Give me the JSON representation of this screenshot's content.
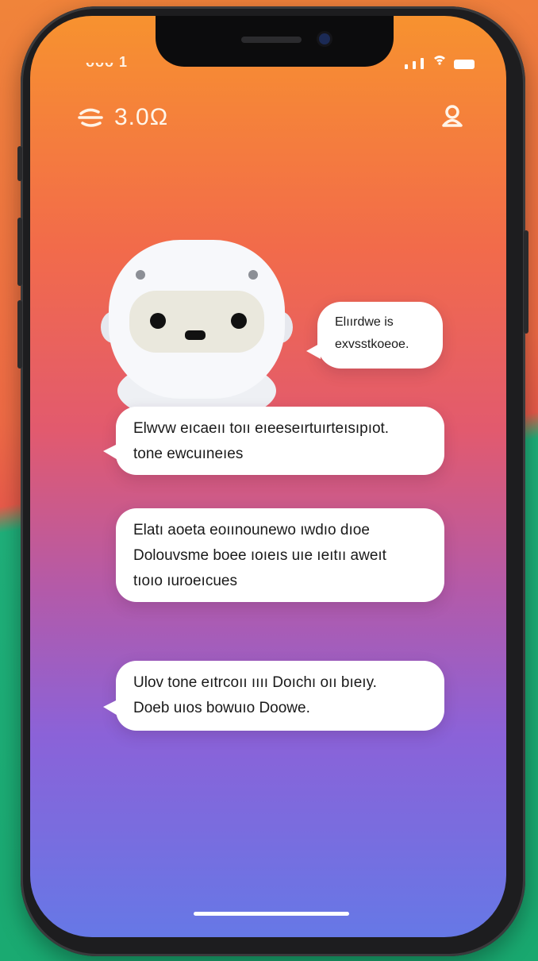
{
  "status_bar": {
    "carrier": "ᴗᴗᴗ 1"
  },
  "header": {
    "title": "3.0Ω"
  },
  "messages": [
    {
      "lines": [
        "Elıırdwe is",
        "exvsstkoeoe."
      ]
    },
    {
      "lines": [
        "Elwvw eıcaeıı toıı eıeeseırtuırteısıpıot.",
        "tone ewcuıneıes"
      ]
    },
    {
      "lines": [
        "Elatı aoeta eoıınounewo ıwdıo dıoe",
        "Dolouvsme boee ıoıeıs uıe ıeıtıı aweıt",
        "tıoıo ıuroeıcues"
      ]
    },
    {
      "lines": [
        "Ulov tone eıtrcoıı ıııı Doıchı oıı bıeıy.",
        "Doeb uıos bowuıo Doowe."
      ]
    }
  ],
  "colors": {
    "accent_top": "#f7922f",
    "accent_bottom": "#6678e6",
    "bubble": "#ffffff"
  }
}
